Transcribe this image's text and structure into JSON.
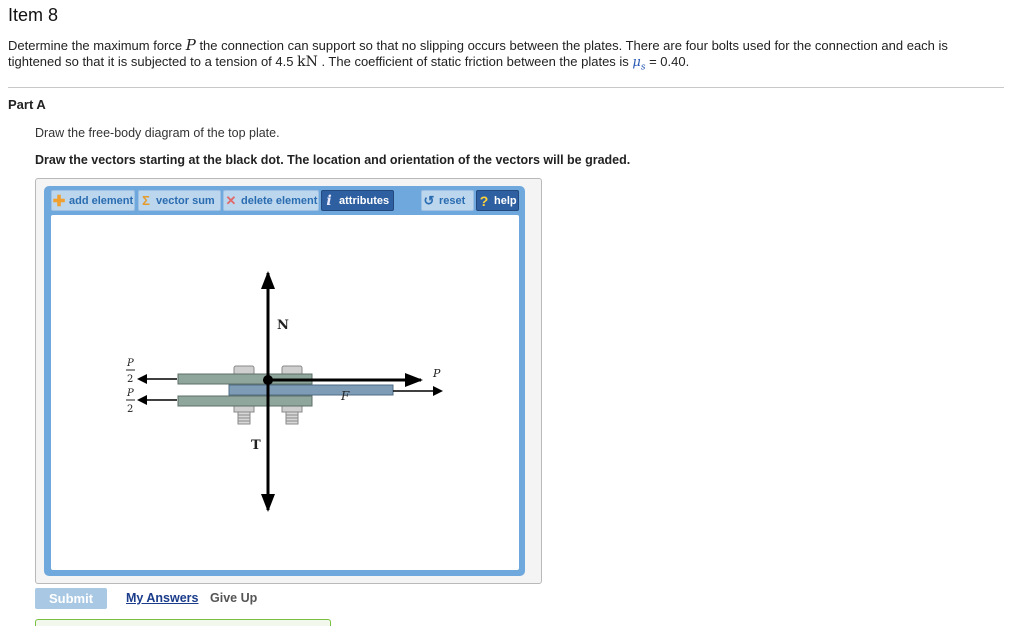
{
  "header": {
    "item_title": "Item 8"
  },
  "problem": {
    "text_1": "Determine the maximum force ",
    "var_P": "P",
    "text_2": " the connection can support so that no slipping occurs between the plates. There are four bolts used for the connection and each is tightened so that it is subjected to a tension of 4.5 ",
    "unit_kN": "kN",
    "text_3": " . The coefficient of static friction between the plates is ",
    "mu": "μ",
    "mu_sub": "s",
    "text_4": " = 0.40."
  },
  "part": {
    "title": "Part A",
    "instruction": "Draw the free-body diagram of the top plate.",
    "instruction_bold": "Draw the vectors starting at the black dot. The location and orientation of the vectors will be graded."
  },
  "toolbar": {
    "add_element": "add element",
    "vector_sum": "vector sum",
    "delete_element": "delete element",
    "attributes": "attributes",
    "reset": "reset",
    "help": "help"
  },
  "diagram": {
    "label_N": "N",
    "label_T": "T",
    "label_F": "F",
    "label_P": "P",
    "half_P_num": "P",
    "half_P_den": "2",
    "colors": {
      "plate_top": "#8fa69d",
      "plate_bottom": "#6f8faa",
      "bolt": "#c9c9c9",
      "vector": "#000000"
    }
  },
  "actions": {
    "submit": "Submit",
    "my_answers": "My Answers",
    "give_up": "Give Up"
  }
}
